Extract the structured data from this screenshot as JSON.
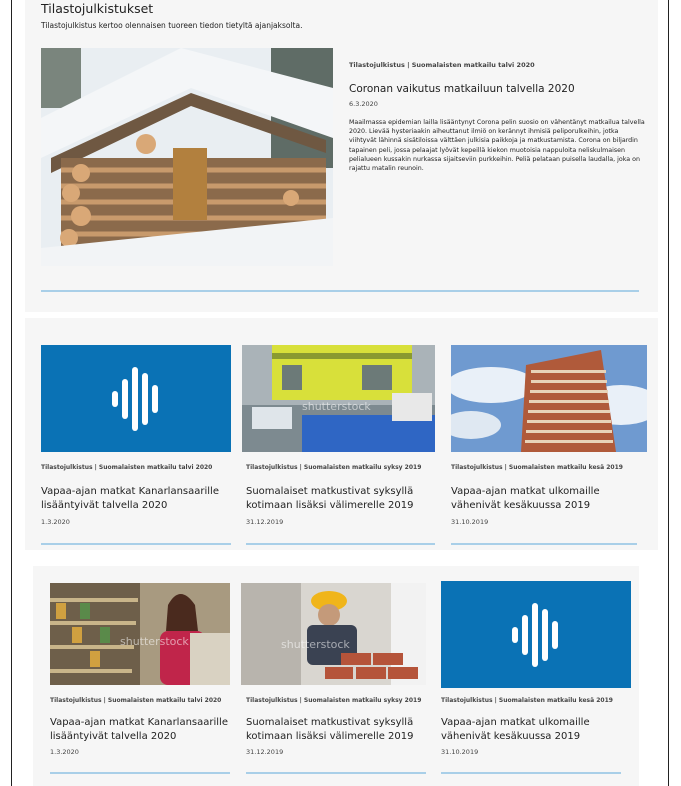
{
  "header": {
    "title": "Tilastojulkistukset",
    "subtitle": "Tilastojulkistus kertoo olennaisen tuoreen tiedon tietyltä ajanjaksolta."
  },
  "featured": {
    "category": "Tilastojulkistus | Suomalaisten matkailu talvi 2020",
    "title": "Coronan vaikutus matkailuun talvella 2020",
    "date": "6.3.2020",
    "body": "Maailmassa epidemian lailla lisääntynyt Corona pelin suosio on vähentänyt matkailua talvella 2020. Lievää hysteriaakin aiheuttanut ilmiö on kerännyt ihmisiä peliporulkeihin, jotka viihtyvät lähinnä sisätiloissa välttäen julkisia paikkoja ja matkustamista. Corona on biljardin tapainen peli, jossa pelaajat lyövät kepeillä kiekon muotoisia nappuloita neliskulmaisen pelialueen kussakin nurkassa sijaitseviin purkkeihin. Peliä pelataan puisella laudalla, joka on rajattu matalin reunoin."
  },
  "row1": [
    {
      "category": "Tilastojulkistus | Suomalaisten matkailu talvi 2020",
      "title_line1": "Vapaa-ajan matkat Kanarlansaarille",
      "title_line2": "lisääntyivät talvella 2020",
      "date": "1.3.2020",
      "image": "statistics-logo"
    },
    {
      "category": "Tilastojulkistus | Suomalaisten matkailu syksy 2019",
      "title_line1": "Suomalaiset matkustivat syksyllä",
      "title_line2": "kotimaan lisäksi välimerelle 2019",
      "date": "31.12.2019",
      "image": "ferry-terminal-photo"
    },
    {
      "category": "Tilastojulkistus | Suomalaisten matkailu kesä 2019",
      "title_line1": "Vapaa-ajan matkat ulkomaille",
      "title_line2": "vähenivät kesäkuussa 2019",
      "date": "31.10.2019",
      "image": "apartment-tower-photo"
    }
  ],
  "row2": [
    {
      "category": "Tilastojulkistus | Suomalaisten matkailu talvi 2020",
      "title_line1": "Vapaa-ajan matkat Kanarlansaarille",
      "title_line2": "lisääntyivät talvella 2020",
      "date": "1.3.2020",
      "image": "grocery-store-photo"
    },
    {
      "category": "Tilastojulkistus | Suomalaisten matkailu syksy 2019",
      "title_line1": "Suomalaiset matkustivat syksyllä",
      "title_line2": "kotimaan lisäksi välimerelle 2019",
      "date": "31.12.2019",
      "image": "bricklayer-photo"
    },
    {
      "category": "Tilastojulkistus | Suomalaisten matkailu kesä 2019",
      "title_line1": "Vapaa-ajan matkat ulkomaille",
      "title_line2": "vähenivät kesäkuussa 2019",
      "date": "31.10.2019",
      "image": "statistics-logo"
    }
  ],
  "colors": {
    "accent": "#0a72b5",
    "rule": "#a9cfe8",
    "panel": "#f6f6f6"
  }
}
